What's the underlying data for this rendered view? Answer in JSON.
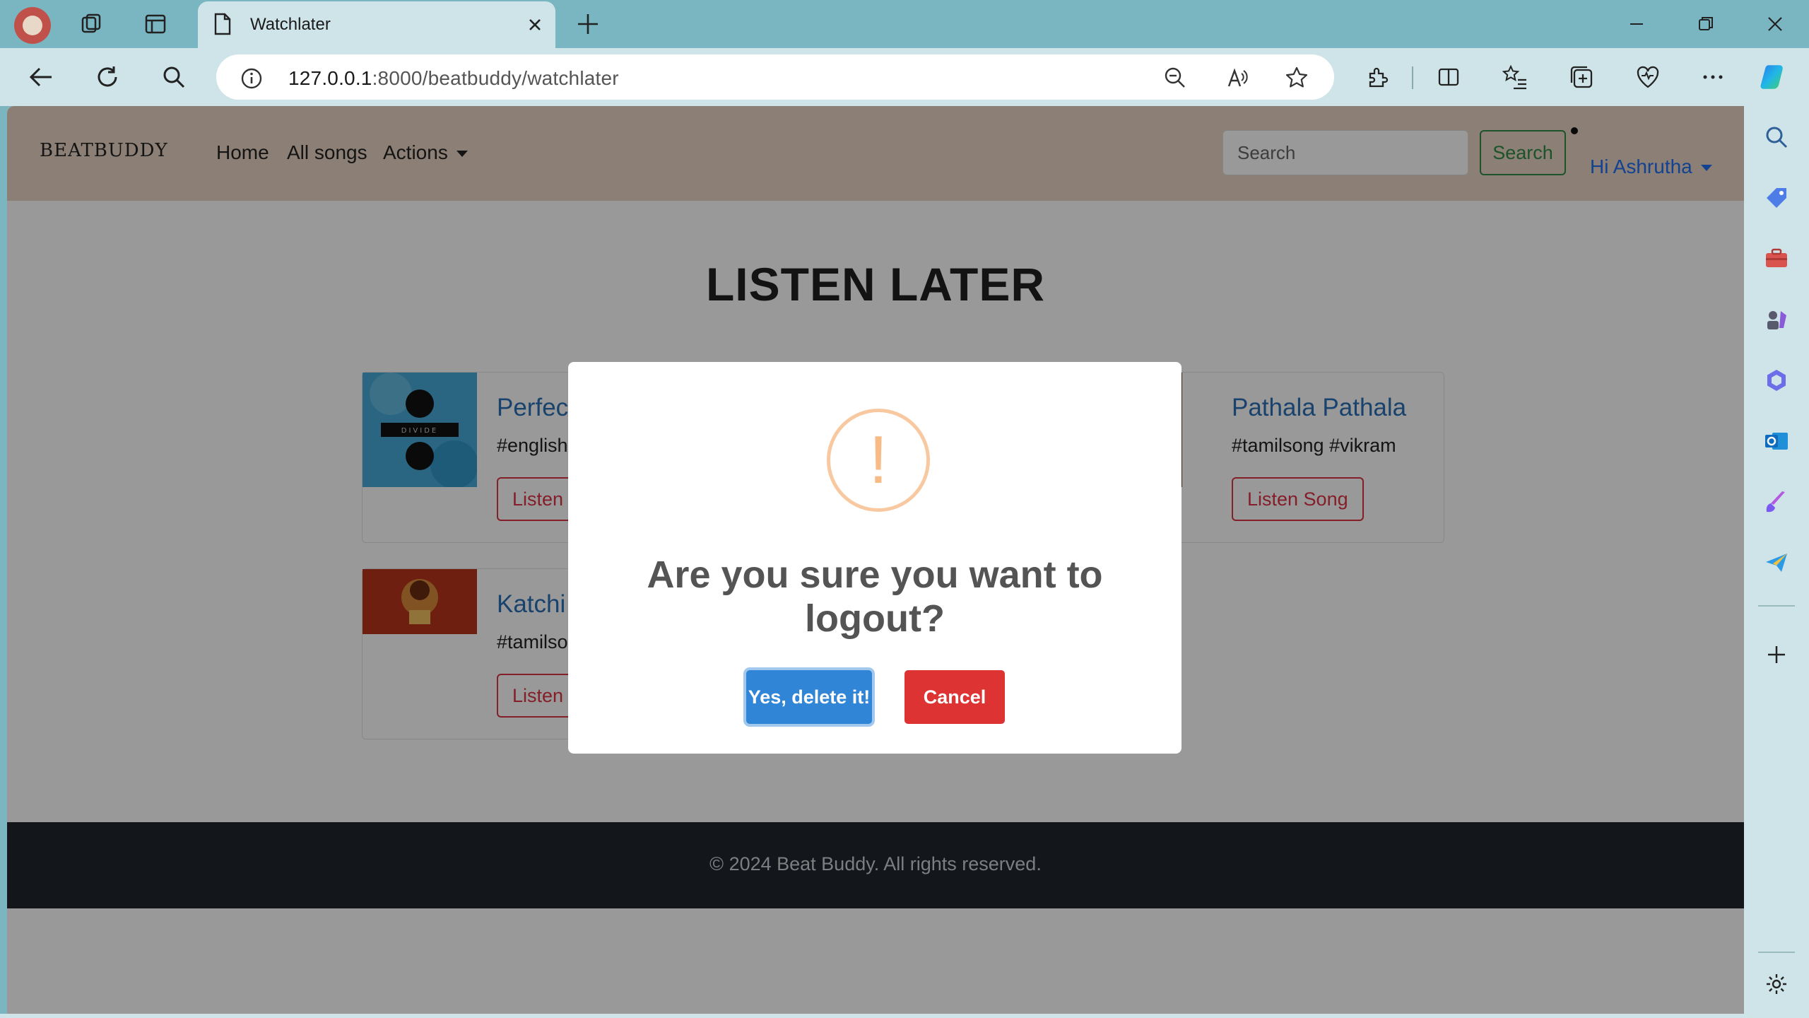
{
  "browser": {
    "tab_title": "Watchlater",
    "url_host": "127.0.0.1",
    "url_rest": ":8000/beatbuddy/watchlater"
  },
  "site": {
    "brand": "BEATBUDDY",
    "nav": {
      "home": "Home",
      "all_songs": "All songs",
      "actions": "Actions"
    },
    "search": {
      "placeholder": "Search",
      "button": "Search"
    },
    "user_greeting": "Hi Ashrutha"
  },
  "page": {
    "heading": "LISTEN LATER",
    "cards": [
      {
        "title": "Perfect",
        "tags": "#english",
        "button": "Listen Song"
      },
      {
        "title": "Pathala Pathala",
        "tags": "#tamilsong #vikram",
        "button": "Listen Song"
      },
      {
        "title": "Katchi s",
        "tags": "#tamilso",
        "button": "Listen Song"
      }
    ],
    "footer": "© 2024 Beat Buddy. All rights reserved."
  },
  "dialog": {
    "icon_glyph": "!",
    "title": "Are you sure you want to logout?",
    "confirm": "Yes, delete it!",
    "cancel": "Cancel"
  },
  "colors": {
    "navbar_bg": "#e9d4c3",
    "confirm_btn": "#3085d6",
    "cancel_btn": "#dd3333",
    "warning_icon": "#f8bb86"
  }
}
